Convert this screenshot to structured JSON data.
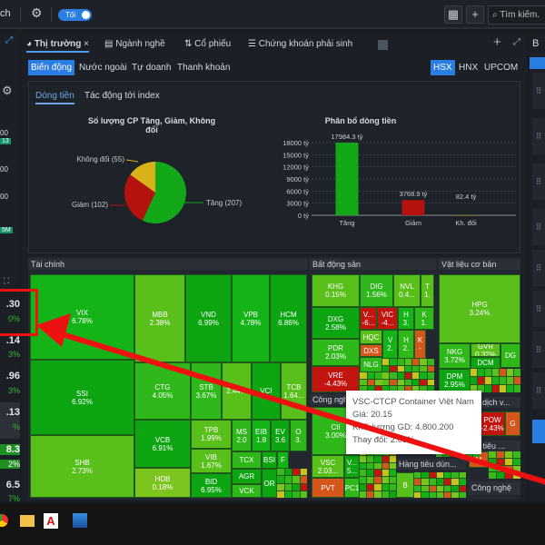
{
  "topbar": {
    "left_text": "ch",
    "theme_toggle": "Tối",
    "search_placeholder": "Tìm kiếm."
  },
  "left_strip": {
    "badge1": "13",
    "badge2": "5M",
    "v1": "00",
    "v2": "00",
    "v3": "00",
    "rows": [
      {
        "value": ".30",
        "pct": "0%"
      },
      {
        "value": ".14",
        "pct": "3%"
      },
      {
        "value": ".96",
        "pct": "3%"
      },
      {
        "value": ".13",
        "pct": "%"
      },
      {
        "value": "8.3",
        "pct": "2%"
      },
      {
        "value": "6.5",
        "pct": "7%"
      }
    ]
  },
  "tabs": [
    {
      "label": "Thị trường",
      "close": "×"
    },
    {
      "label": "Ngành nghề"
    },
    {
      "label": "Cổ phiếu"
    },
    {
      "label": "Chứng khoán phải sinh"
    }
  ],
  "right_panel": {
    "title": "B"
  },
  "subtabs": [
    "Biến động",
    "Nước ngoài",
    "Tự doanh",
    "Thanh khoản"
  ],
  "exchanges": [
    "HSX",
    "HNX",
    "UPCOM"
  ],
  "flow_tabs": [
    "Dòng tiền",
    "Tác động tới index"
  ],
  "pie": {
    "title": "Số lượng CP Tăng, Giảm, Không đổi",
    "slices": [
      {
        "label": "Tăng (207)",
        "value": 207,
        "color": "#13a817"
      },
      {
        "label": "Giảm (102)",
        "value": 102,
        "color": "#b4120e"
      },
      {
        "label": "Không đổi (55)",
        "value": 55,
        "color": "#d9b21a"
      }
    ]
  },
  "chart_data": {
    "type": "bar",
    "title": "Phân bổ dòng tiền",
    "categories": [
      "Tăng",
      "Giảm",
      "Kh. đổi"
    ],
    "values": [
      17984.3,
      3768.9,
      82.4
    ],
    "value_labels": [
      "17984.3 tỷ",
      "3768.9 tỷ",
      "82.4 tỷ"
    ],
    "colors": [
      "#14a818",
      "#b4120e",
      "#8a8a2a"
    ],
    "yticks": [
      "0 tỷ",
      "3000 tỷ",
      "6000 tỷ",
      "9000 tỷ",
      "12000 tỷ",
      "15000 tỷ",
      "18000 tỷ"
    ],
    "ylim": [
      0,
      18000
    ]
  },
  "treemap": {
    "sectors": [
      "Tài chính",
      "Bất động sản",
      "Vật liệu cơ bản",
      "Công nghiệp",
      "Hàng tiêu dùn...",
      "dịch v...",
      "ng tiêu ...",
      "Công nghệ"
    ],
    "cells": {
      "VIX": [
        "VIX",
        "6.78%"
      ],
      "SSI": [
        "SSI",
        "6.92%"
      ],
      "SHB": [
        "SHB",
        "2.73%"
      ],
      "MBB": [
        "MBB",
        "2.38%"
      ],
      "VND": [
        "VND",
        "6.99%"
      ],
      "VPB": [
        "VPB",
        "4.78%"
      ],
      "HCM": [
        "HCM",
        "6.86%"
      ],
      "CTG": [
        "CTG",
        "4.05%"
      ],
      "STB": [
        "STB",
        "3.67%"
      ],
      "HDB2": [
        "",
        "2.44%"
      ],
      "VCI": [
        "VCI",
        ""
      ],
      "TCB": [
        "TCB",
        "1.64..."
      ],
      "VCB": [
        "VCB",
        "6.91%"
      ],
      "HDB": [
        "HDB",
        "0.18%"
      ],
      "TPB": [
        "TPB",
        "1.99%"
      ],
      "VIB": [
        "VIB",
        "1.67%"
      ],
      "BID": [
        "BID",
        "6.95%"
      ],
      "MS": [
        "MS",
        "2.0"
      ],
      "EIB": [
        "EIB",
        "1.8"
      ],
      "EV": [
        "EV",
        "3.6"
      ],
      "O": [
        "O",
        "3."
      ],
      "TCX": [
        "TCX",
        ""
      ],
      "BSI": [
        "BSI",
        ""
      ],
      "F": [
        "F",
        ""
      ],
      "AGR": [
        "AGR",
        ""
      ],
      "OR": [
        "OR",
        ""
      ],
      "VCK": [
        "VCK",
        ""
      ],
      "KHG": [
        "KHG",
        "0.15%"
      ],
      "DIG": [
        "DIG",
        "1.56%"
      ],
      "NVL": [
        "NVL",
        "0.4..."
      ],
      "T": [
        "T",
        "1."
      ],
      "DXG": [
        "DXG",
        "2.58%"
      ],
      "V1": [
        "V...",
        "-6..."
      ],
      "VIC": [
        "VIC",
        "-4..."
      ],
      "H1": [
        "H",
        "3."
      ],
      "K1": [
        "K",
        "1."
      ],
      "PDR": [
        "PDR",
        "2.03%"
      ],
      "HQC": [
        "HQC",
        ""
      ],
      "DXS": [
        "DXS",
        ""
      ],
      "NLG": [
        "NLG",
        ""
      ],
      "V2": [
        "V",
        "2."
      ],
      "H2": [
        "H",
        "2."
      ],
      "K2": [
        "K",
        "-"
      ],
      "VRE": [
        "VRE",
        "-4.43%"
      ],
      "CII": [
        "CII",
        "3.00%"
      ],
      "VSC": [
        "VSC",
        "2.03..."
      ],
      "V3": [
        "V...",
        "5..."
      ],
      "PVT": [
        "PVT",
        ""
      ],
      "PC1": [
        "PC1",
        ""
      ],
      "L": [
        "L",
        ""
      ],
      "B": [
        "B",
        ""
      ],
      "HPG": [
        "HPG",
        "3.24%"
      ],
      "NKG": [
        "NKG",
        "3.72%"
      ],
      "GVR": [
        "GVR",
        "0.32%"
      ],
      "DG": [
        "DG",
        ""
      ],
      "DCM": [
        "DCM",
        ""
      ],
      "DPM": [
        "DPM",
        "2.95%"
      ],
      "POW": [
        "POW",
        "-2.43%"
      ],
      "G": [
        "G",
        ""
      ],
      "M": [
        "M",
        ""
      ]
    }
  },
  "tooltip": {
    "title": "VSC-CTCP Container Việt Nam",
    "price_label": "Giá:",
    "price": "20.15",
    "volume_label": "Khối lượng GD:",
    "volume": "4.800.200",
    "change_label": "Thay đổi:",
    "change": "2.03%"
  }
}
